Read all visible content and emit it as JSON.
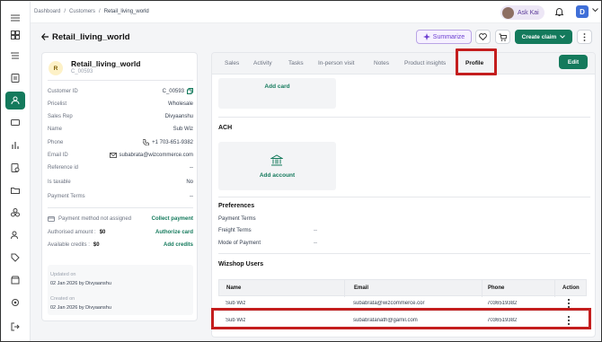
{
  "topbar": {
    "breadcrumb": [
      "Dashboard",
      "/",
      "Customers",
      "/",
      "Retail_living_world"
    ],
    "ask_kai": "Ask Kai",
    "user_initial": "D"
  },
  "header": {
    "title": "Retail_living_world",
    "summarize": "Summarize",
    "create_claim": "Create claim"
  },
  "customer": {
    "initial": "R",
    "name": "Retail_living_world",
    "code": "C_00593",
    "fields": [
      {
        "label": "Customer ID",
        "value": "C_00593"
      },
      {
        "label": "Pricelist",
        "value": "Wholesale"
      },
      {
        "label": "Sales Rep",
        "value": "Divyaanshu"
      },
      {
        "label": "Name",
        "value": "Sub Wiz"
      },
      {
        "label": "Phone",
        "value": "+1 703-651-9382"
      },
      {
        "label": "Email ID",
        "value": "subabrata@wizcommerce.com"
      },
      {
        "label": "Reference id",
        "value": "--"
      },
      {
        "label": "Is taxable",
        "value": "No"
      },
      {
        "label": "Payment Terms",
        "value": "--"
      }
    ],
    "payment": {
      "method_label": "Payment method not assigned",
      "collect": "Collect payment",
      "authorised_label": "Authorised amount :",
      "authorised_value": "$0",
      "authorize": "Authorize card",
      "credits_label": "Available credits :",
      "credits_value": "$0",
      "add_credits": "Add credits"
    },
    "meta": {
      "updated_label": "Updated on",
      "updated_value": "02 Jan 2026 by Divyaanshu",
      "created_label": "Created on",
      "created_value": "02 Jan 2026 by Divyaanshu"
    }
  },
  "tabs": [
    "Sales",
    "Activity",
    "Tasks",
    "In-person visit",
    "Notes",
    "Product insights",
    "Profile"
  ],
  "active_tab": "Profile",
  "edit": "Edit",
  "profile": {
    "add_card": "Add card",
    "ach_title": "ACH",
    "add_account": "Add account",
    "preferences_title": "Preferences",
    "pref_rows": [
      {
        "label": "Payment Terms",
        "value": ""
      },
      {
        "label": "Freight Terms",
        "value": "--"
      },
      {
        "label": "Mode of Payment",
        "value": "--"
      }
    ],
    "wizshop_title": "Wizshop Users",
    "table": {
      "headers": [
        "Name",
        "Email",
        "Phone",
        "Action"
      ],
      "rows": [
        {
          "name": "Sub Wiz",
          "email": "subabrata@wizcommerce.cor",
          "phone": "7036519382"
        },
        {
          "name": "Sub Wiz",
          "email": "subabratanath@gamil.com",
          "phone": "7036519382"
        }
      ]
    }
  },
  "colors": {
    "brand": "#147a5c",
    "highlight": "#c41e1e",
    "summarize": "#6d3fd1"
  }
}
